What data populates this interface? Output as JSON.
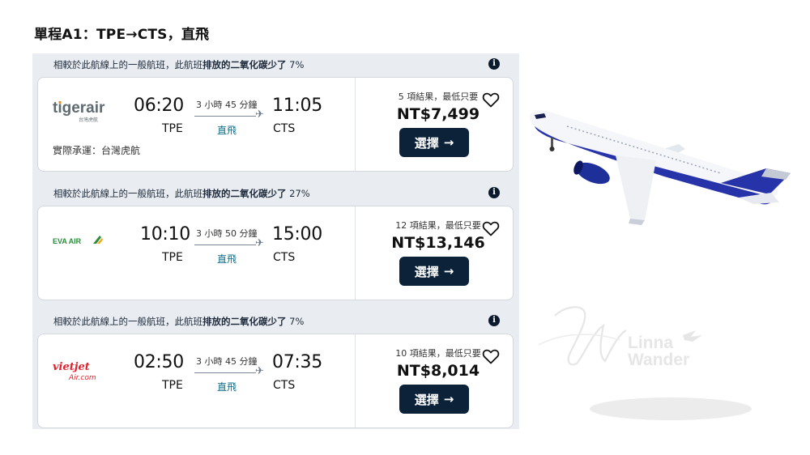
{
  "page_title": "單程A1：TPE→CTS，直飛",
  "info_icon_glyph": "i",
  "select_arrow": "→",
  "flights": [
    {
      "eco_prefix": "相較於此航線上的一般航班，此航班",
      "eco_bold": "排放的二氧化碳少了",
      "eco_value": "7%",
      "airline_logo": "tigerair",
      "logo_sub": "台灣虎航",
      "dep_time": "06:20",
      "arr_time": "11:05",
      "dep_code": "TPE",
      "arr_code": "CTS",
      "duration": "3 小時 45 分鐘",
      "stops": "直飛",
      "operated_by": "實際承運：台灣虎航",
      "results": "5 項結果，最低只要",
      "price": "NT$7,499",
      "select_label": "選擇"
    },
    {
      "eco_prefix": "相較於此航線上的一般航班，此航班",
      "eco_bold": "排放的二氧化碳少了",
      "eco_value": "27%",
      "airline_logo": "EVA AIR",
      "logo_sub": "",
      "dep_time": "10:10",
      "arr_time": "15:00",
      "dep_code": "TPE",
      "arr_code": "CTS",
      "duration": "3 小時 50 分鐘",
      "stops": "直飛",
      "operated_by": "",
      "results": "12 項結果，最低只要",
      "price": "NT$13,146",
      "select_label": "選擇"
    },
    {
      "eco_prefix": "相較於此航線上的一般航班，此航班",
      "eco_bold": "排放的二氧化碳少了",
      "eco_value": "7%",
      "airline_logo": "vietjet",
      "logo_sub": "Air.com",
      "dep_time": "02:50",
      "arr_time": "07:35",
      "dep_code": "TPE",
      "arr_code": "CTS",
      "duration": "3 小時 45 分鐘",
      "stops": "直飛",
      "operated_by": "",
      "results": "10 項結果，最低只要",
      "price": "NT$8,014",
      "select_label": "選擇"
    }
  ],
  "watermark": {
    "line1": "Linna",
    "line2": "Wander"
  },
  "colors": {
    "accent_button": "#0b2239",
    "stops_text": "#0a6e8a",
    "eco_bar": "#e9edf2",
    "tigerair": "#f28c1c",
    "eva": "#2e8b3d",
    "vietjet": "#e4202c"
  }
}
